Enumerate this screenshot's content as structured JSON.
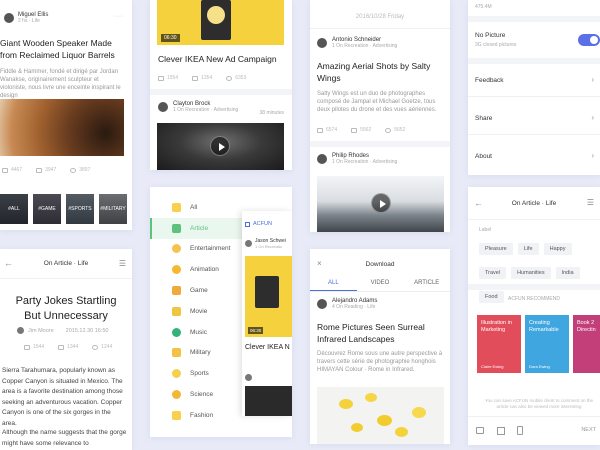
{
  "col1": {
    "card1": {
      "author": "Miguel Ellis",
      "meta": "2 hs · Life",
      "title": "Giant Wooden Speaker Made from Reclaimed Liquor Barrels",
      "body": "Fiddle & Hammer, fondé et dirigé par Jordan Wanakse, originairement sculpteur et violoniste, nous livre une enceinte inspirant le design",
      "views": "4467",
      "comments": "3947",
      "likes": "3897",
      "tags": [
        "#ALL",
        "#GAME",
        "#SPORTS",
        "#MILITARY"
      ]
    },
    "card2": {
      "nav_title": "On Article · Life",
      "title": "Party Jokes Startling But Unnecessary",
      "author": "Jim Moore",
      "date": "2015.12.30  16:50",
      "views": "1544",
      "comments": "1344",
      "likes": "1244",
      "para1": "Sierra Tarahumara, popularly known as Copper Canyon is situated in Mexico. The area is a favorite destination among those seeking an adventurous vacation. Copper Canyon is one of the six gorges in the area.",
      "para2": "Although the name suggests that the gorge might have some relevance to"
    }
  },
  "col2": {
    "card1": {
      "duration": "06:30",
      "title": "Clever IKEA New Ad Campaign",
      "views": "1554",
      "comments": "1354",
      "likes": "6353",
      "author2": "Clayton Brock",
      "meta2": "1 On Recreation · Advertising",
      "mins2": "38 minutes"
    },
    "card2": {
      "categories": [
        {
          "label": "All",
          "color": "#f8d04b"
        },
        {
          "label": "Article",
          "color": "#5cc27c"
        },
        {
          "label": "Entertainment",
          "color": "#f6c24e"
        },
        {
          "label": "Animation",
          "color": "#f5b830"
        },
        {
          "label": "Game",
          "color": "#f0a93a"
        },
        {
          "label": "Movie",
          "color": "#f0c542"
        },
        {
          "label": "Music",
          "color": "#34b27b"
        },
        {
          "label": "Military",
          "color": "#f3c244"
        },
        {
          "label": "Sports",
          "color": "#f4d14c"
        },
        {
          "label": "Science",
          "color": "#f2b737"
        },
        {
          "label": "Fashion",
          "color": "#f8d04b"
        }
      ],
      "overlay": {
        "brand": "ACFUN",
        "author": "Jason Schwei",
        "meta": "1 On Recreatio",
        "duration": "06:30",
        "title": "Clever IKEA N"
      }
    }
  },
  "col3": {
    "card1": {
      "date": "2016/10/28 Friday",
      "author1": "Antonio Schneider",
      "meta1": "1 On Recreation · Advertising",
      "title1": "Amazing Aerial Shots by Salty Wings",
      "body1": "Salty Wings est un duo de photographes composé de Jampal et Michael Goetze, tous deux pilotes du drone et des vues aériennes.",
      "views1": "6574",
      "comments1": "5562",
      "likes1": "5652",
      "author2": "Philip Rhodes",
      "meta2": "1 On Recreation · Advertising"
    },
    "card2": {
      "title": "Download",
      "tabs": [
        "ALL",
        "VIDEO",
        "ARTICLE"
      ],
      "author": "Alejandro Adams",
      "meta": "4 On Reading · Life",
      "article_title": "Rome Pictures Seen Surreal Infrared Landscapes",
      "body": "Découvrez Rome sous une autre perspective à travers cette série de photographie honghois HIMAYAN Colour · Rome in Infrared."
    }
  },
  "col4": {
    "card1": {
      "storage": "475.4M",
      "no_picture": "No Picture",
      "no_picture_sub": "3G closed pictures",
      "menu": [
        "Feedback",
        "Share",
        "About"
      ]
    },
    "card2": {
      "nav_title": "On Article · Life",
      "label_head": "Label",
      "tags": [
        "Pleasure",
        "Life",
        "Happy",
        "Travel",
        "Humanities",
        "India",
        "Food"
      ],
      "rec_head": "ACFUN RECOMMEND",
      "recs": [
        {
          "title": "Illustration in Marketing",
          "author": "Claire Ewing",
          "color": "#e24d5b"
        },
        {
          "title": "Creating Remarkable",
          "author": "Dora Ewing",
          "color": "#3fa6e0"
        },
        {
          "title": "Book 2 Directin",
          "author": "",
          "color": "#c23f7a"
        }
      ],
      "notice": "You can save ACFUN mobile client to comment on the article can also be viewed more interesting",
      "next": "NEXT"
    }
  }
}
